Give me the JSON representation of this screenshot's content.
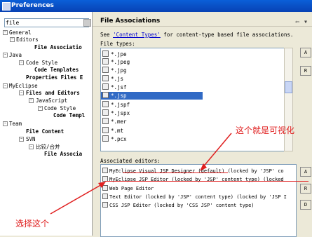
{
  "window": {
    "title": "Preferences"
  },
  "filter": {
    "value": "file"
  },
  "tree": [
    {
      "label": "General",
      "bold": false
    },
    {
      "label": "Editors",
      "bold": false
    },
    {
      "label": "File Associatio",
      "bold": true
    },
    {
      "label": "Java",
      "bold": false
    },
    {
      "label": "Code Style",
      "bold": false
    },
    {
      "label": "Code Templates",
      "bold": true
    },
    {
      "label": "Properties Files E",
      "bold": true
    },
    {
      "label": "MyEclipse",
      "bold": false
    },
    {
      "label": "Files and Editors",
      "bold": true
    },
    {
      "label": "JavaScript",
      "bold": false
    },
    {
      "label": "Code Style",
      "bold": false
    },
    {
      "label": "Code Templ",
      "bold": true
    },
    {
      "label": "Team",
      "bold": false
    },
    {
      "label": "File Content",
      "bold": true
    },
    {
      "label": "SVN",
      "bold": false
    },
    {
      "label": "比较/合并",
      "bold": false
    },
    {
      "label": "File Associa",
      "bold": true
    }
  ],
  "page": {
    "title": "File Associations",
    "nav_arrows": "⇦ ▾",
    "desc_prefix": "See ",
    "desc_link": "'Content Types'",
    "desc_suffix": " for content-type based file associations.",
    "file_types_label": "File types:",
    "assoc_label": "Associated editors:"
  },
  "file_types": [
    "*.jpe",
    "*.jpeg",
    "*.jpg",
    "*.js",
    "*.jsf",
    "*.jsp",
    "*.jspf",
    "*.jspx",
    "*.mer",
    "*.mt",
    "*.pcx"
  ],
  "selected_file_type": "*.jsp",
  "buttons": {
    "a1": "A",
    "r1": "R",
    "a2": "A",
    "r2": "R",
    "d": "D"
  },
  "editors": [
    "MyEclipse Visual JSP Designer (default) (locked by 'JSP' co",
    "MyEclipse JSP Editor (locked by 'JSP' content type) (locked",
    "Web Page Editor",
    "Text Editor (locked by 'JSP' content type) (locked by 'JSP I",
    "CSS JSP Editor (locked by 'CSS JSP' content type)"
  ],
  "annotations": {
    "visual": "这个就是可视化",
    "select": "选择这个"
  },
  "colors": {
    "accent": "#316ac5",
    "annotation": "#e02020",
    "titlebar": "#0a5fd8"
  }
}
